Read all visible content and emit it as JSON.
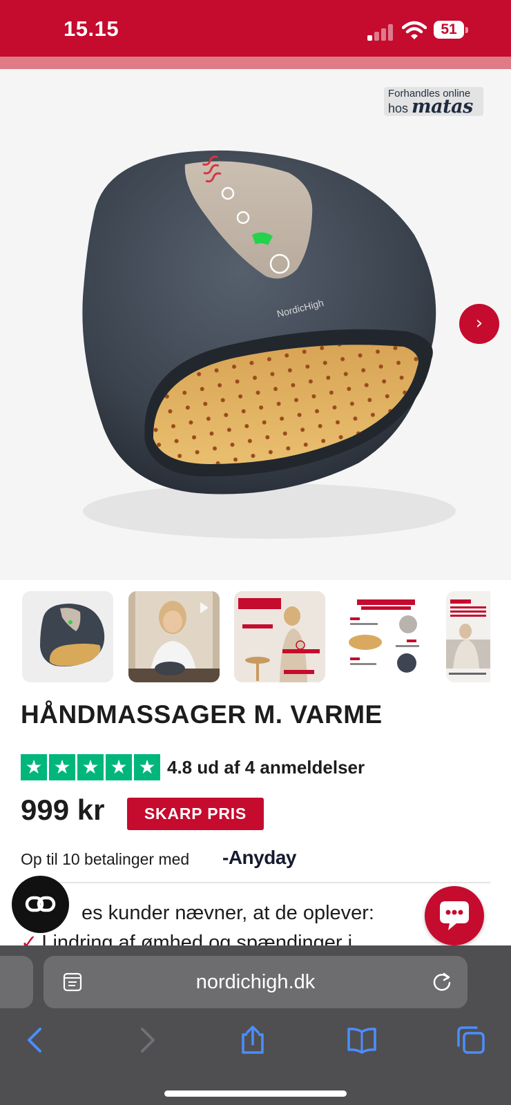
{
  "status_bar": {
    "time": "15.15",
    "battery": "51"
  },
  "hero": {
    "badge_line1": "Forhandles online",
    "badge_prefix": "hos",
    "badge_brand": "matas",
    "product_logo_text": "NordicHigh",
    "next_label": "›"
  },
  "thumbnails": [
    {
      "name": "thumb-product"
    },
    {
      "name": "thumb-video"
    },
    {
      "title": "LINDRING OG BEDRE CIRKULATION",
      "tags": [
        "LINDRER HÅNDSMERTER",
        "FORBEDRER CIRKULATION",
        "MINDSKER STIVHED"
      ]
    },
    {
      "title": "HVORDAN MAN BRUGER HÅNDMASSAGER M. VARME",
      "steps": [
        "STEP 1",
        "STEP 2",
        "STEP 3"
      ]
    },
    {
      "title": "Før brug",
      "caption": "Dette er hvad vores kund"
    }
  ],
  "product": {
    "title": "HÅNDMASSAGER M. VARME",
    "rating_text": "4.8 ud af 4 anmeldelser",
    "price": "999 kr",
    "sale_badge": "SKARP PRIS",
    "installments": "Op til 10 betalinger med",
    "anyday_logo": "-Anyday",
    "customers_text": "es kunder nævner, at de oplever:",
    "benefit_1": "Lindring af ømhed og spændinger i"
  },
  "browser": {
    "url": "nordichigh.dk"
  },
  "colors": {
    "brand_red": "#c50b2e",
    "trustpilot_green": "#00b67a",
    "browser_bar": "#4f4f51"
  },
  "icons": [
    "signal-icon",
    "wifi-icon",
    "battery-icon",
    "chevron-right-icon",
    "star-icon",
    "link-icon",
    "chat-icon",
    "tabs-icon",
    "reload-icon",
    "back-icon",
    "forward-icon",
    "share-icon",
    "bookmarks-icon",
    "tab-overview-icon"
  ]
}
